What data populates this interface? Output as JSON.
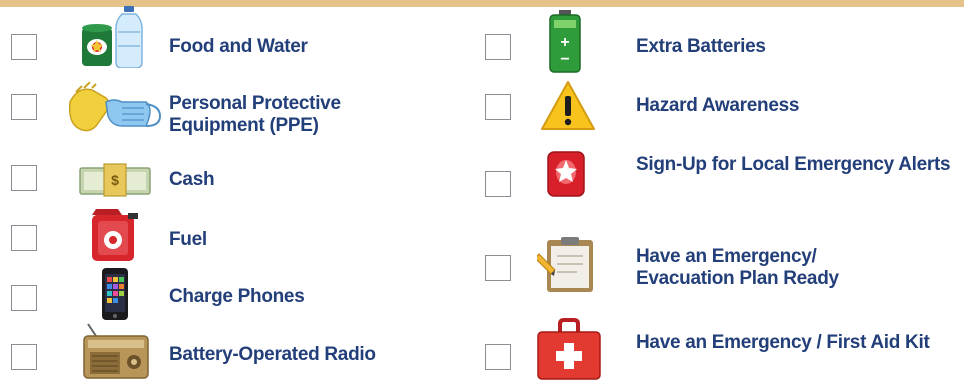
{
  "colors": {
    "top_border": "#e6c28b",
    "label_text": "#233f7a",
    "checkbox_border": "#8a8f96"
  },
  "items": [
    {
      "label": "Food and Water",
      "icon": "food-water-icon",
      "checked": false
    },
    {
      "label": "Personal Protective Equipment (PPE)",
      "icon": "ppe-icon",
      "checked": false
    },
    {
      "label": "Cash",
      "icon": "cash-icon",
      "checked": false
    },
    {
      "label": "Fuel",
      "icon": "fuel-icon",
      "checked": false
    },
    {
      "label": "Charge Phones",
      "icon": "phone-icon",
      "checked": false
    },
    {
      "label": "Battery-Operated Radio",
      "icon": "radio-icon",
      "checked": false
    },
    {
      "label": "Extra Batteries",
      "icon": "battery-icon",
      "checked": false
    },
    {
      "label": "Hazard Awareness",
      "icon": "hazard-icon",
      "checked": false
    },
    {
      "label": "Sign-Up for Local Emergency Alerts",
      "icon": "alert-icon",
      "checked": false
    },
    {
      "label": "Have an Emergency/ Evacuation Plan Ready",
      "icon": "clipboard-icon",
      "checked": false
    },
    {
      "label": "Have an Emergency / First Aid Kit",
      "icon": "first-aid-kit-icon",
      "checked": false
    }
  ]
}
